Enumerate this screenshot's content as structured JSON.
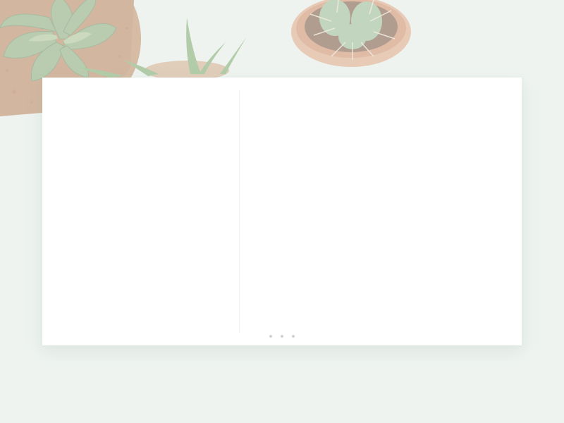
{
  "colors": {
    "background": "#eef3f0",
    "card": "#ffffff",
    "divider": "#f1f3f2",
    "dot": "#cfd3d1",
    "succulent_green": "#9ab58a",
    "cactus_green": "#a8c3a0",
    "terracotta": "#d99a78",
    "cork_pot": "#c89a78"
  },
  "decor": {
    "image": "succulent-and-cactus-plants-photo"
  },
  "card": {
    "left_panel": {},
    "right_panel": {}
  },
  "pager": {
    "dot_count": 3
  }
}
